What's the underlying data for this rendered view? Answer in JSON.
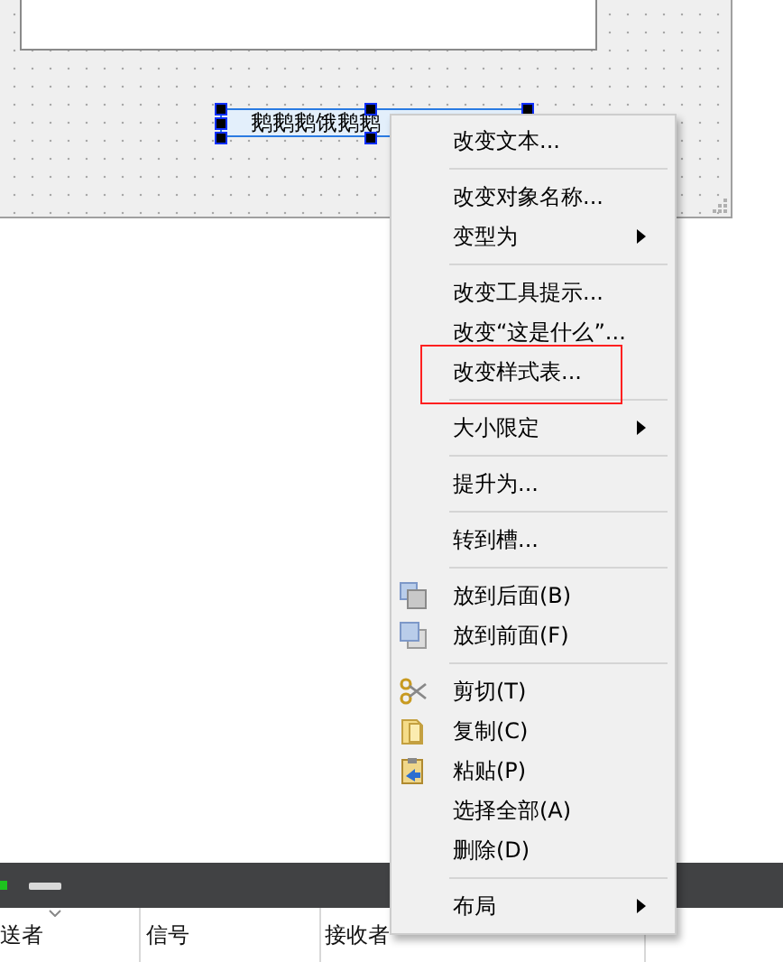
{
  "canvas": {
    "label_widget": {
      "text": "鹅鹅鹅饿鹅鹅"
    }
  },
  "bottom_panel": {
    "columns": [
      {
        "label": "送者"
      },
      {
        "label": "信号"
      },
      {
        "label": "接收者"
      }
    ]
  },
  "context_menu": {
    "items": [
      {
        "kind": "action",
        "label": "改变文本...",
        "highlighted": false
      },
      {
        "kind": "separator"
      },
      {
        "kind": "action",
        "label": "改变对象名称...",
        "highlighted": false
      },
      {
        "kind": "submenu",
        "label": "变型为",
        "highlighted": false
      },
      {
        "kind": "separator"
      },
      {
        "kind": "action",
        "label": "改变工具提示...",
        "highlighted": false
      },
      {
        "kind": "action",
        "label": "改变“这是什么”...",
        "highlighted": false
      },
      {
        "kind": "action",
        "label": "改变样式表...",
        "highlighted": true
      },
      {
        "kind": "separator"
      },
      {
        "kind": "submenu",
        "label": "大小限定",
        "highlighted": false
      },
      {
        "kind": "separator"
      },
      {
        "kind": "action",
        "label": "提升为...",
        "highlighted": false
      },
      {
        "kind": "separator"
      },
      {
        "kind": "action",
        "label": "转到槽...",
        "highlighted": false
      },
      {
        "kind": "separator"
      },
      {
        "kind": "layer-back",
        "label": "放到后面(B)",
        "highlighted": false
      },
      {
        "kind": "layer-front",
        "label": "放到前面(F)",
        "highlighted": false
      },
      {
        "kind": "separator"
      },
      {
        "kind": "cut",
        "label": "剪切(T)",
        "highlighted": false
      },
      {
        "kind": "copy",
        "label": "复制(C)",
        "highlighted": false
      },
      {
        "kind": "paste",
        "label": "粘贴(P)",
        "highlighted": false
      },
      {
        "kind": "action",
        "label": "选择全部(A)",
        "highlighted": false
      },
      {
        "kind": "action",
        "label": "删除(D)",
        "highlighted": false
      },
      {
        "kind": "separator"
      },
      {
        "kind": "submenu",
        "label": "布局",
        "highlighted": false
      }
    ]
  }
}
